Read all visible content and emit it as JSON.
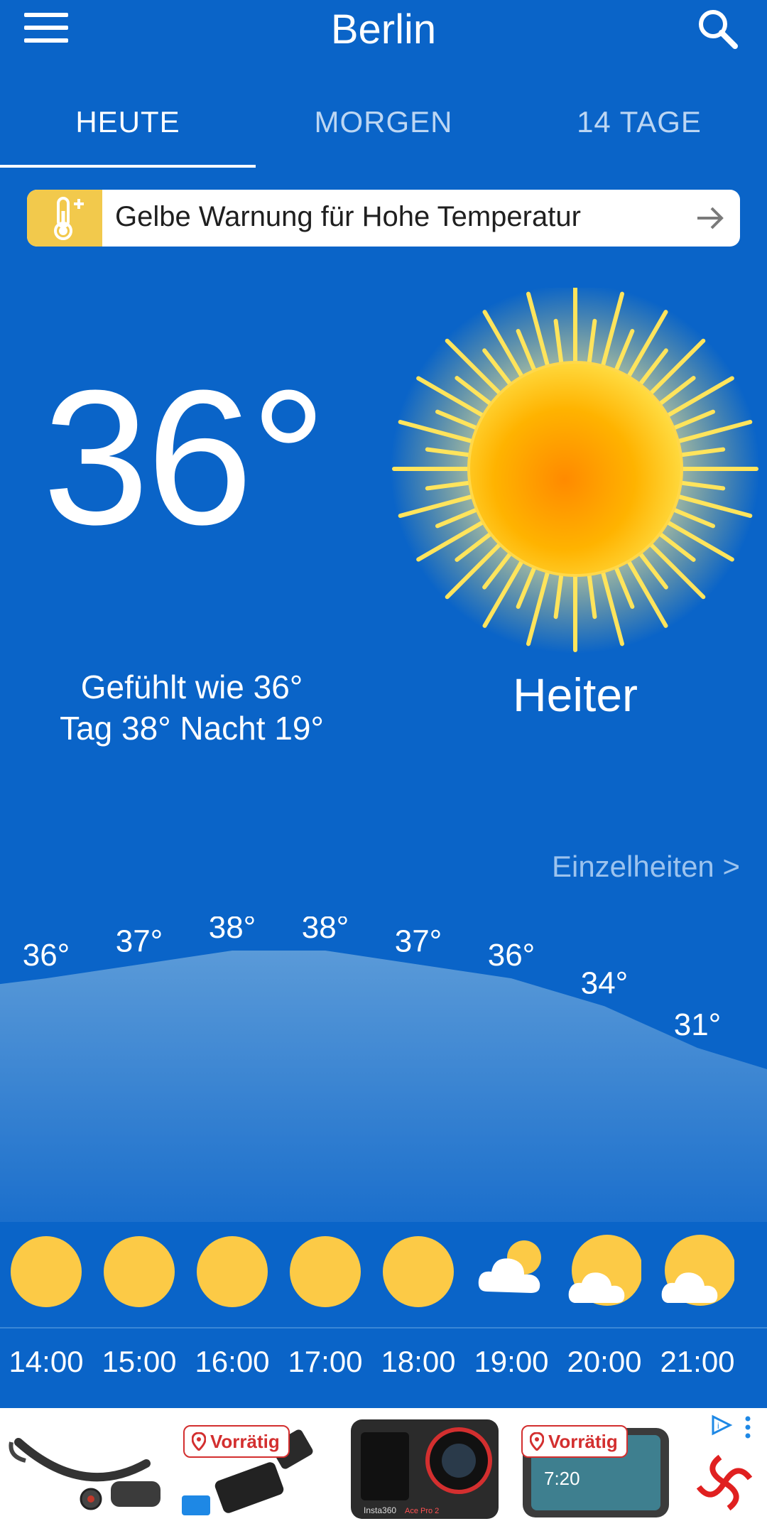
{
  "header": {
    "city": "Berlin"
  },
  "tabs": [
    {
      "label": "HEUTE",
      "active": true
    },
    {
      "label": "MORGEN",
      "active": false
    },
    {
      "label": "14 TAGE",
      "active": false
    }
  ],
  "warning": {
    "text": "Gelbe Warnung für Hohe Temperatur",
    "color": "#f2c94c"
  },
  "current": {
    "temperature": "36°",
    "feels_like": "Gefühlt wie 36°",
    "day_night": "Tag 38° Nacht 19°",
    "condition": "Heiter",
    "details_link": "Einzelheiten >"
  },
  "hourly": [
    {
      "time": "14:00",
      "temp": "36°",
      "icon": "sun"
    },
    {
      "time": "15:00",
      "temp": "37°",
      "icon": "sun"
    },
    {
      "time": "16:00",
      "temp": "38°",
      "icon": "sun"
    },
    {
      "time": "17:00",
      "temp": "38°",
      "icon": "sun"
    },
    {
      "time": "18:00",
      "temp": "37°",
      "icon": "sun"
    },
    {
      "time": "19:00",
      "temp": "36°",
      "icon": "partly-cloudy"
    },
    {
      "time": "20:00",
      "temp": "34°",
      "icon": "sun-behind-cloud"
    },
    {
      "time": "21:00",
      "temp": "31°",
      "icon": "sun-behind-cloud"
    }
  ],
  "ad": {
    "badges": [
      "Vorrätig",
      "Vorrätig"
    ],
    "camera_brand": "Insta360",
    "camera_model": "Ace Pro 2",
    "display_time": "7:20"
  },
  "colors": {
    "background": "#0a64c8",
    "sun": "#fcca46",
    "accent": "#f2c94c"
  }
}
